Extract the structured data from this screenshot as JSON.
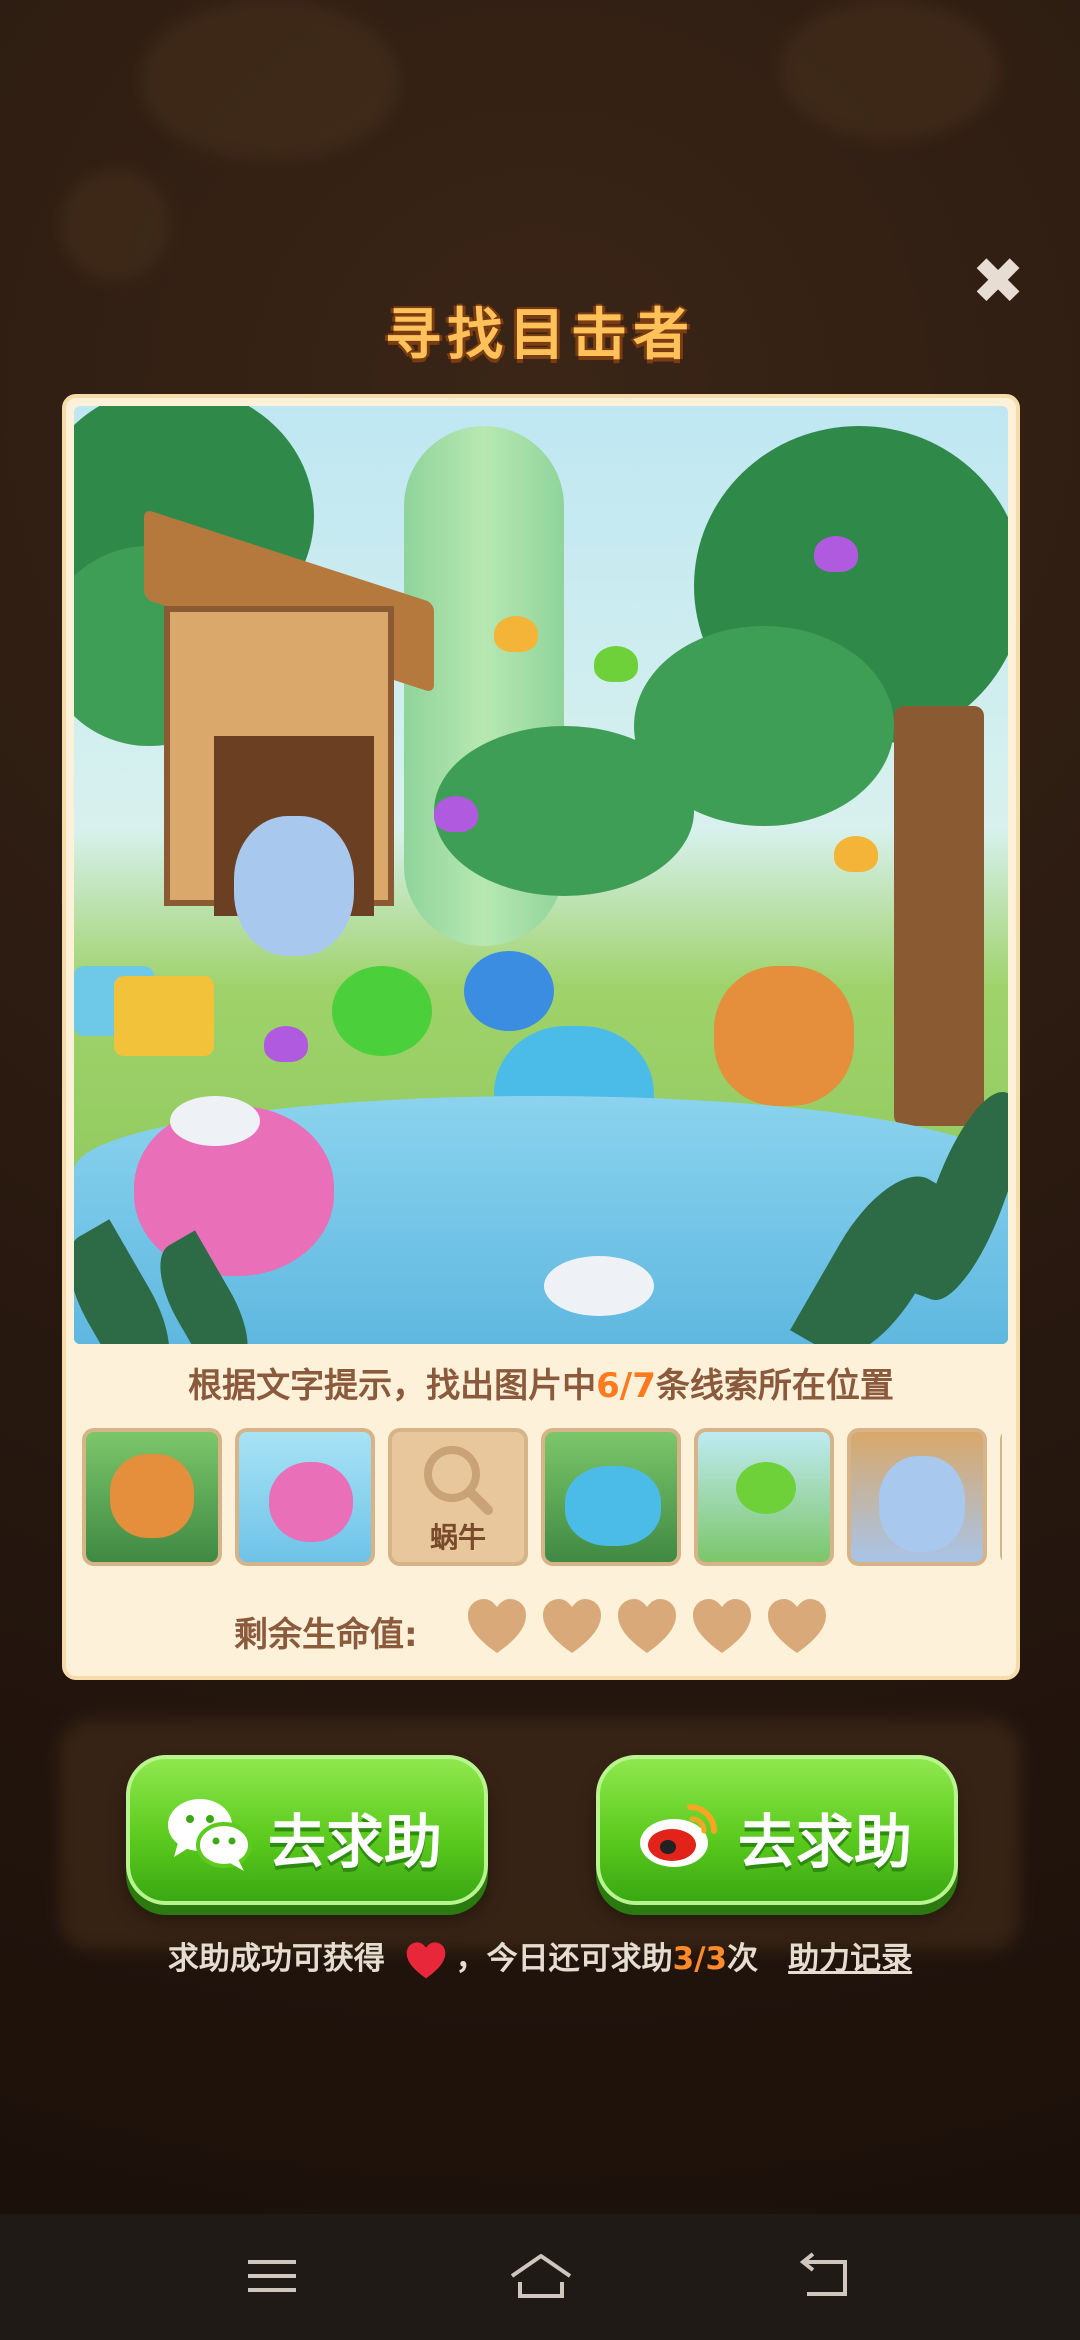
{
  "dialog": {
    "title": "寻找目击者",
    "close_glyph": "✖"
  },
  "clue": {
    "prefix": "根据文字提示，找出图片中",
    "progress": "6/7",
    "suffix": "条线索所在位置"
  },
  "thumbnails": [
    {
      "name": "squirrel",
      "found": true
    },
    {
      "name": "octopus",
      "found": true
    },
    {
      "name": "snail",
      "found": false,
      "label": "蜗牛"
    },
    {
      "name": "blue-cat",
      "found": true
    },
    {
      "name": "green-butterfly",
      "found": true
    },
    {
      "name": "yeti",
      "found": true
    }
  ],
  "lives": {
    "label": "剩余生命值:",
    "count": 5,
    "color": "#d9a97a"
  },
  "buttons": {
    "wechat_label": "去求助",
    "weibo_label": "去求助"
  },
  "footer": {
    "prefix": "求助成功可获得",
    "middle": "，今日还可求助",
    "count": "3/3",
    "suffix": "次",
    "link": "助力记录"
  },
  "colors": {
    "accent": "#ff7a1e",
    "button_green": "#5ccb1e",
    "title_gold": "#ffc15a"
  }
}
